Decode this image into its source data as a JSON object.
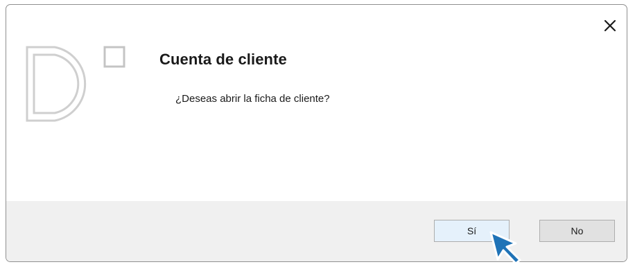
{
  "dialog": {
    "title": "Cuenta de cliente",
    "message": "¿Deseas abrir la ficha de cliente?",
    "close_icon": "close-icon",
    "logo_icon": "d-logo-icon"
  },
  "buttons": {
    "yes_label": "Sí",
    "no_label": "No"
  },
  "colors": {
    "accent_cursor": "#1f73b7",
    "footer_bg": "#f0f0f0",
    "logo_gray": "#c8c8c8"
  }
}
